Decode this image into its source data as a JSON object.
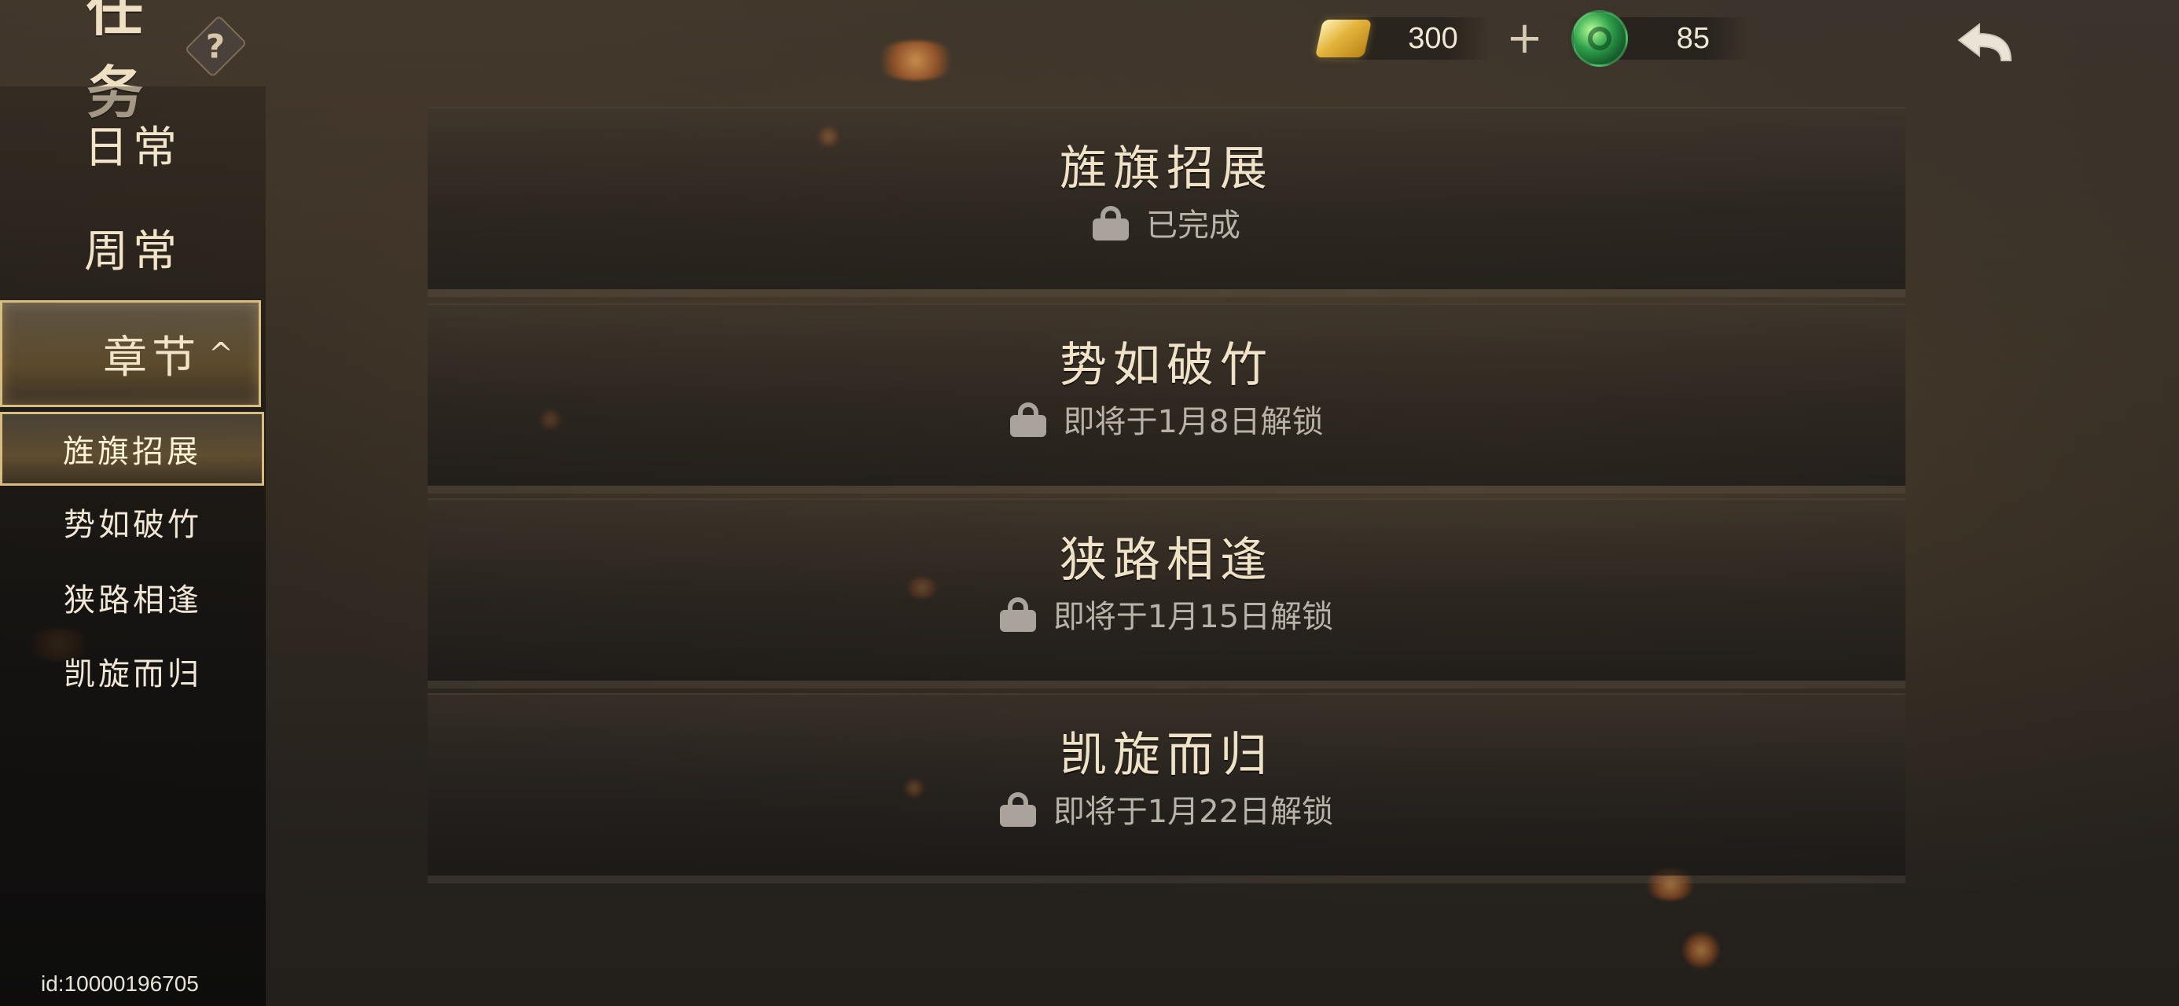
{
  "header": {
    "title": "任务",
    "help_symbol": "?"
  },
  "sidebar": {
    "items": [
      {
        "label": "日常"
      },
      {
        "label": "周常"
      },
      {
        "label": "章节"
      }
    ],
    "chapter_subitems": [
      {
        "label": "旌旗招展",
        "selected": true
      },
      {
        "label": "势如破竹",
        "selected": false
      },
      {
        "label": "狭路相逢",
        "selected": false
      },
      {
        "label": "凯旋而归",
        "selected": false
      }
    ]
  },
  "currency": {
    "gold_value": "300",
    "plus_symbol": "+",
    "jade_value": "85",
    "gold_icon": "gold-ingot-icon",
    "jade_icon": "jade-token-icon"
  },
  "cards": [
    {
      "title": "旌旗招展",
      "status": "已完成"
    },
    {
      "title": "势如破竹",
      "status": "即将于1月8日解锁"
    },
    {
      "title": "狭路相逢",
      "status": "即将于1月15日解锁"
    },
    {
      "title": "凯旋而归",
      "status": "即将于1月22日解锁"
    }
  ],
  "footer": {
    "id_text": "id:10000196705"
  },
  "colors": {
    "text_primary": "#f1e4c8",
    "text_secondary": "#b9b2a8",
    "accent_border": "#d8bc82"
  }
}
